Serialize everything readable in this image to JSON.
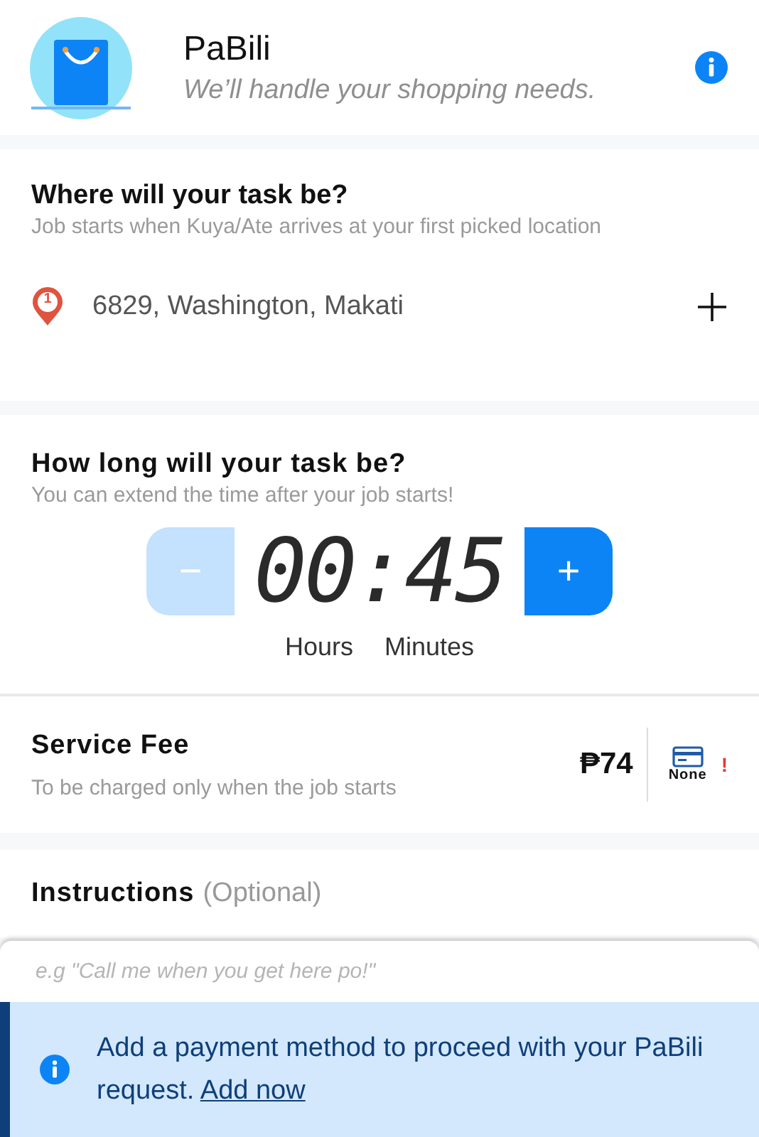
{
  "header": {
    "title": "PaBili",
    "subtitle": "We’ll handle your shopping needs."
  },
  "location": {
    "title": "Where will your task be?",
    "subtitle": "Job starts when Kuya/Ate arrives at your first picked location",
    "stops": [
      {
        "number": "1",
        "address": "6829, Washington, Makati"
      }
    ]
  },
  "duration": {
    "title": "How long will your task be?",
    "subtitle": "You can extend the time after your job starts!",
    "time": "00:45",
    "units": [
      "Hours",
      "Minutes"
    ],
    "decrease": {
      "label": "−",
      "disabled": true
    },
    "increase": {
      "label": "+",
      "disabled": false
    }
  },
  "fee": {
    "title": "Service Fee",
    "subtitle": "To be charged only when the job starts",
    "amount": "₱74",
    "payment": "None",
    "alert": "!"
  },
  "instructions": {
    "title": "Instructions",
    "optional": "(Optional)",
    "placeholder": "e.g \"Call me when you get here po!\""
  },
  "banner": {
    "message": "Add a payment method to proceed with your PaBili request.",
    "link": "Add now"
  }
}
